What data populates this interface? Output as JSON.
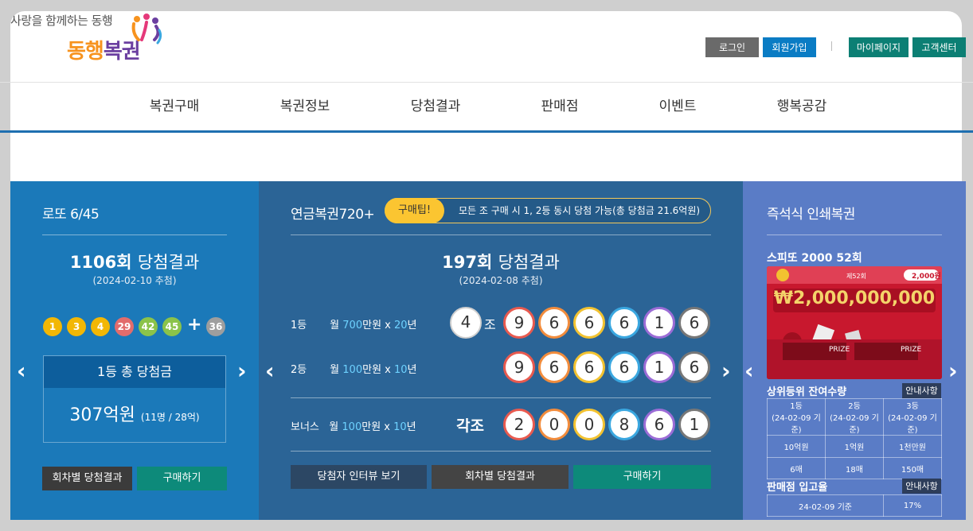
{
  "header": {
    "slogan": "사랑을 함께하는 동행",
    "logo_part1": "동행",
    "logo_part2": "복권",
    "login": "로그인",
    "join": "회원가입",
    "mypage": "마이페이지",
    "customer_center": "고객센터"
  },
  "nav": [
    "복권구매",
    "복권정보",
    "당첨결과",
    "판매점",
    "이벤트",
    "행복공감"
  ],
  "lotto": {
    "title": "로또 6/45",
    "round": "1106회",
    "round_suffix": "당첨결과",
    "date": "(2024-02-10 추첨)",
    "numbers": [
      {
        "n": "1",
        "color": "#f2b705"
      },
      {
        "n": "3",
        "color": "#f2b705"
      },
      {
        "n": "4",
        "color": "#f2b705"
      },
      {
        "n": "29",
        "color": "#e26c6c"
      },
      {
        "n": "42",
        "color": "#8bc34a"
      },
      {
        "n": "45",
        "color": "#8bc34a"
      }
    ],
    "plus": "+",
    "bonus": {
      "n": "36",
      "color": "#9e9e9e"
    },
    "prize_label": "1등 총 당첨금",
    "prize_amount": "307억원",
    "prize_detail": "(11명 / 28억)",
    "btn_by_round": "회차별 당첨결과",
    "btn_buy": "구매하기"
  },
  "pension": {
    "title": "연금복권720+",
    "tip_badge": "구매팁!",
    "tip_text": "모든 조 구매 시 1, 2등 동시 당첨 가능(총 당첨금 21.6억원)",
    "round": "197회",
    "round_suffix": "당첨결과",
    "date": "(2024-02-08 추첨)",
    "rank1_label": "1등",
    "rank1_prefix": "월",
    "rank1_amount": "700",
    "rank1_unit": "만원 x",
    "rank1_years": "20",
    "rank1_year_unit": "년",
    "rank2_label": "2등",
    "rank2_prefix": "월",
    "rank2_amount": "100",
    "rank2_unit": "만원 x",
    "rank2_years": "10",
    "rank2_year_unit": "년",
    "bonus_label": "보너스",
    "bonus_prefix": "월",
    "bonus_amount": "100",
    "bonus_unit": "만원 x",
    "bonus_years": "10",
    "bonus_year_unit": "년",
    "group": "4",
    "group_unit": "조",
    "all_groups": "각조",
    "digit_colors": [
      "#e85a4f",
      "#f28c3c",
      "#f2c230",
      "#3aa7e0",
      "#9b6cd6",
      "#777777"
    ],
    "rank1_digits": [
      "9",
      "6",
      "6",
      "6",
      "1",
      "6"
    ],
    "rank2_digits": [
      "9",
      "6",
      "6",
      "6",
      "1",
      "6"
    ],
    "bonus_digits": [
      "2",
      "0",
      "0",
      "8",
      "6",
      "1"
    ],
    "btn_interview": "당첨자 인터뷰 보기",
    "btn_by_round": "회차별 당첨결과",
    "btn_buy": "구매하기"
  },
  "instant": {
    "title": "즉석식 인쇄복권",
    "product": "스피또 2000 52회",
    "ticket_round": "제52회",
    "ticket_price": "2,000원",
    "ticket_prize": "₩2,000,000,000",
    "ticket_label1": "PRIZE",
    "ticket_label2": "PRIZE",
    "remain_title": "상위등위 잔여수량",
    "guide": "안내사항",
    "remain_head": [
      [
        "1등",
        "(24-02-09 기준)"
      ],
      [
        "2등",
        "(24-02-09 기준)"
      ],
      [
        "3등",
        "(24-02-09 기준)"
      ]
    ],
    "remain_prize": [
      "10억원",
      "1억원",
      "1천만원"
    ],
    "remain_count": [
      "6매",
      "18매",
      "150매"
    ],
    "store_title": "판매점 입고율",
    "store_guide": "안내사항",
    "store_date": "24-02-09 기준",
    "store_rate": "17%"
  }
}
